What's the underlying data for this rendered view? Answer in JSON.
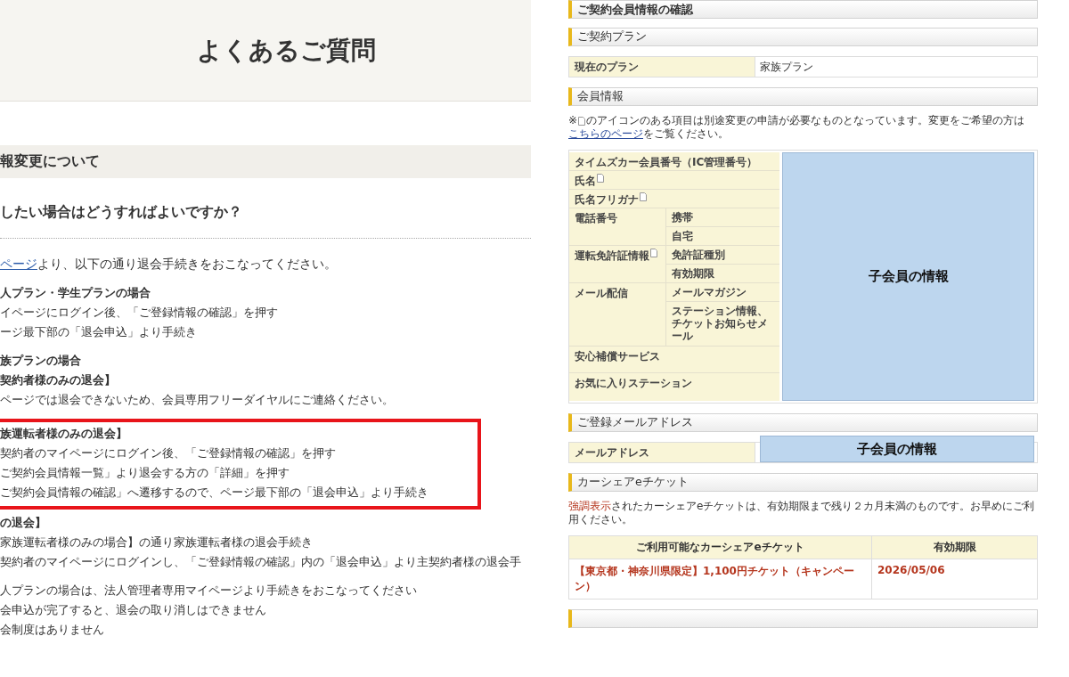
{
  "faq": {
    "title": "よくあるご質問",
    "section": "報変更について",
    "question": "したい場合はどうすればよいですか？",
    "intro": {
      "link": "ページ",
      "text": "より、以下の通り退会手続きをおこなってください。"
    },
    "blocks": [
      {
        "lines": [
          {
            "text": "人プラン・学生プランの場合",
            "bold": true
          },
          {
            "text": "イページにログイン後、「ご登録情報の確認」を押す",
            "bold": false
          },
          {
            "text": "ージ最下部の「退会申込」より手続き",
            "bold": false
          }
        ],
        "highlighted": false
      },
      {
        "lines": [
          {
            "text": "族プランの場合",
            "bold": true
          },
          {
            "text": "契約者様のみの退会】",
            "bold": true
          },
          {
            "text": "ページでは退会できないため、会員専用フリーダイヤルにご連絡ください。",
            "bold": false
          }
        ],
        "highlighted": false
      },
      {
        "lines": [
          {
            "text": "族運転者様のみの退会】",
            "bold": true
          },
          {
            "text": "契約者のマイページにログイン後、「ご登録情報の確認」を押す",
            "bold": false
          },
          {
            "text": "ご契約会員情報一覧」より退会する方の「詳細」を押す",
            "bold": false
          },
          {
            "text": "ご契約会員情報の確認」へ遷移するので、ページ最下部の「退会申込」より手続き",
            "bold": false
          }
        ],
        "highlighted": true
      },
      {
        "lines": [
          {
            "text": "の退会】",
            "bold": true
          },
          {
            "text": "家族運転者様のみの場合】の通り家族運転者様の退会手続き",
            "bold": false
          },
          {
            "text": "契約者のマイページにログインし、「ご登録情報の確認」内の「退会申込」より主契約者様の退会手",
            "bold": false
          }
        ],
        "highlighted": false
      },
      {
        "lines": [
          {
            "text": "人プランの場合は、法人管理者専用マイページより手続きをおこなってください",
            "bold": false
          },
          {
            "text": "会申込が完了すると、退会の取り消しはできません",
            "bold": false
          },
          {
            "text": "会制度はありません",
            "bold": false
          }
        ],
        "highlighted": false
      }
    ]
  },
  "account": {
    "title": "ご契約会員情報の確認",
    "plan": {
      "heading": "ご契約プラン",
      "label": "現在のプラン",
      "value": "家族プラン"
    },
    "member": {
      "heading": "会員情報",
      "note_before": "※",
      "note_mid": "のアイコンのある項目は別途変更の申請が必要なものとなっています。変更をご希望の方は",
      "note_link": "こちらのページ",
      "note_after": "をご覧ください。",
      "overlay": "子会員の情報",
      "fields": [
        {
          "label": "タイムズカー会員番号（IC管理番号）",
          "doc_icon": false
        },
        {
          "label": "氏名",
          "doc_icon": true
        },
        {
          "label": "氏名フリガナ",
          "doc_icon": true
        },
        {
          "label": "電話番号",
          "doc_icon": false,
          "subs": [
            "携帯",
            "自宅"
          ]
        },
        {
          "label": "運転免許証情報",
          "doc_icon": true,
          "subs": [
            "免許証種別",
            "有効期限"
          ]
        },
        {
          "label": "メール配信",
          "doc_icon": false,
          "subs": [
            "メールマガジン",
            "ステーション情報、チケットお知らせメール"
          ]
        },
        {
          "label": "安心補償サービス",
          "doc_icon": false
        },
        {
          "label": "お気に入りステーション",
          "doc_icon": false
        }
      ]
    },
    "email": {
      "heading": "ご登録メールアドレス",
      "label": "メールアドレス",
      "overlay": "子会員の情報"
    },
    "tickets": {
      "heading": "カーシェアeチケット",
      "note_emph": "強調表示",
      "note": "されたカーシェアeチケットは、有効期限まで残り２カ月未満のものです。お早めにご利用ください。",
      "columns": [
        "ご利用可能なカーシェアeチケット",
        "有効期限"
      ],
      "rows": [
        {
          "name": "【東京都・神奈川県限定】1,100円チケット（キャンペーン）",
          "expiry": "2026/05/06",
          "emphasized": true
        }
      ]
    }
  }
}
